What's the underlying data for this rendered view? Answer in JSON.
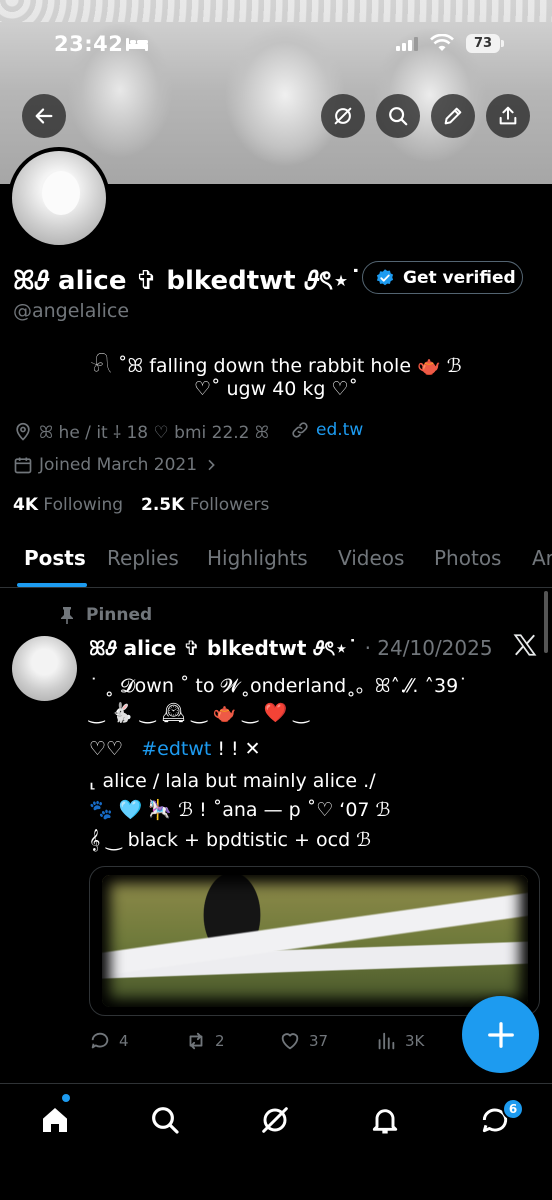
{
  "status": {
    "time": "23:42",
    "battery": "73"
  },
  "profile": {
    "name": "ꕤ𝜗 alice ✞ blkedtwt 𝜗ৎ⋆˙",
    "handle": "@angelalice",
    "verify_label": "Get verified",
    "bio_line1": "𓍯 ˚ꕤ falling down the rabbit hole 🫖 ℬ",
    "bio_line2": "♡˚ ugw 40 kg ♡˚",
    "location": "ꕤ he / it ⸸ 18 ♡ bmi 22.2 ꕤ",
    "link": "ed.tw",
    "joined": "Joined March 2021",
    "following_count": "4K",
    "following_label": "Following",
    "followers_count": "2.5K",
    "followers_label": "Followers"
  },
  "tabs": [
    {
      "label": "Posts"
    },
    {
      "label": "Replies"
    },
    {
      "label": "Highlights"
    },
    {
      "label": "Videos"
    },
    {
      "label": "Photos"
    },
    {
      "label": "Ar"
    }
  ],
  "post": {
    "pinned_label": "Pinned",
    "author": "ꕤ𝜗 alice ✞ blkedtwt 𝜗ৎ⋆˙",
    "date": "· 24/10/2025",
    "line1": "˙ ˳ 𝓓own ˚ to 𝓦˳onderland˳。ꕤ˄.⁄⁄. ˄39˙",
    "line2": "‿ 🐇 ‿ 🕰 ‿ 🫖 ‿ ❤️ ‿",
    "line3_pre": "♡♡",
    "hashtag": "#edtwt",
    "line3_post": "! !          ✕",
    "line4": "⸤ alice / lala but mainly alice ./",
    "line5": "🐾 🩵 🎠 ℬ ! ˚ana — p ˚♡ ‘07 ℬ",
    "line6": "𝄞   ‿ black + bpdtistic + ocd ℬ",
    "replies": "4",
    "reposts": "2",
    "likes": "37",
    "views": "3K"
  },
  "nav": {
    "messages_badge": "6"
  },
  "colors": {
    "accent": "#1d9bf0",
    "muted": "#71767b",
    "background": "#000000"
  }
}
